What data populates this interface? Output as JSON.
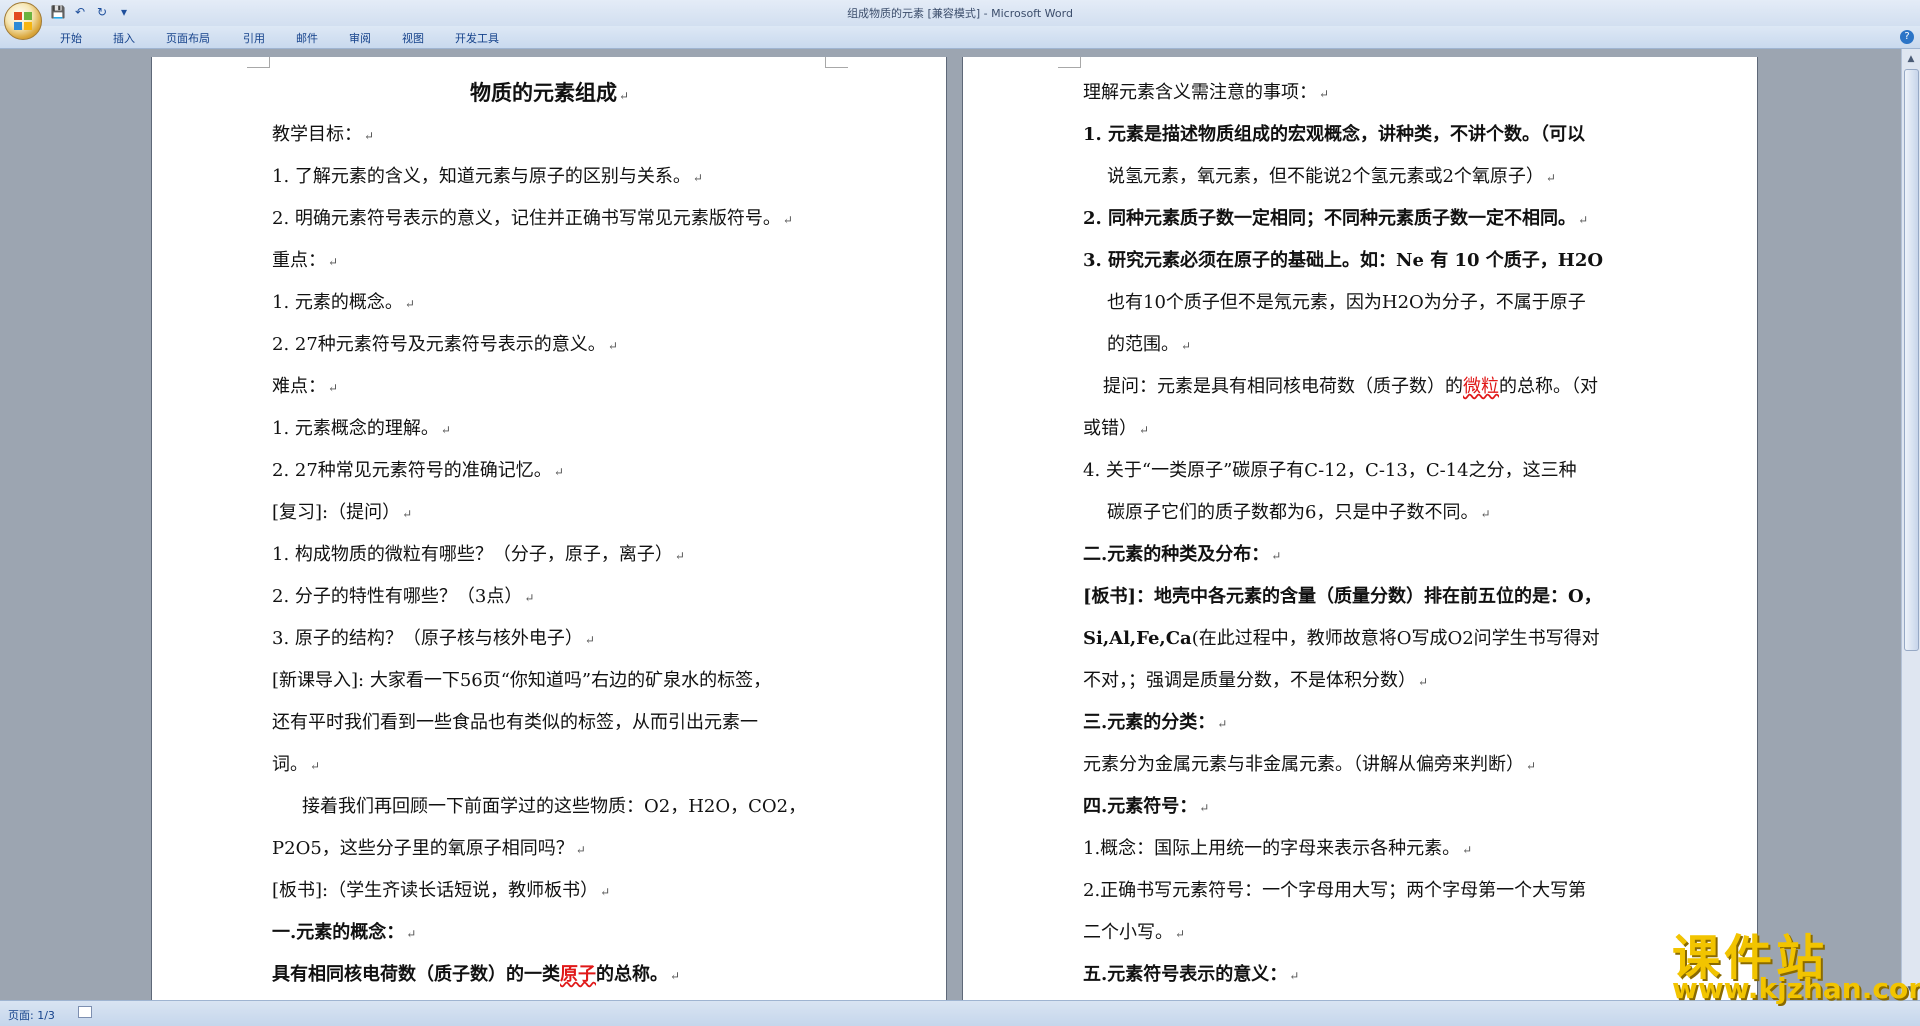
{
  "window": {
    "title": "组成物质的元素 [兼容模式] - Microsoft Word"
  },
  "qat": {
    "save": "💾",
    "undo": "↶",
    "redo": "↻",
    "customize": "▾"
  },
  "ribbon": {
    "tabs": [
      "开始",
      "插入",
      "页面布局",
      "引用",
      "邮件",
      "审阅",
      "视图",
      "开发工具"
    ],
    "help": "?"
  },
  "status": {
    "page": "页面: 1/3"
  },
  "watermark": {
    "brand": "课件站",
    "url": "www.kjzhan.com"
  },
  "colors": {
    "accent": "#15428b",
    "highlight_red": "#e01818",
    "watermark": "#f2c400"
  },
  "doc": {
    "left_page": {
      "title": "物质的元素组成",
      "lines": [
        "教学目标：",
        "1. 了解元素的含义，知道元素与原子的区别与关系。",
        "2. 明确元素符号表示的意义，记住并正确书写常见元素版符号。",
        "重点：",
        "1. 元素的概念。",
        "2. 27种元素符号及元素符号表示的意义。",
        "难点：",
        "1. 元素概念的理解。",
        "2. 27种常见元素符号的准确记忆。",
        "[复习]:（提问）",
        "1. 构成物质的微粒有哪些？（分子，原子，离子）",
        "2. 分子的特性有哪些？（3点）",
        "3. 原子的结构？（原子核与核外电子）",
        "[新课导入]: 大家看一下56页“你知道吗”右边的矿泉水的标签，",
        "还有平时我们看到一些食品也有类似的标签，从而引出元素一",
        "词。",
        "接着我们再回顾一下前面学过的这些物质：O2，H2O，CO2，",
        "P2O5，这些分子里的氧原子相同吗？",
        "[板书]:（学生齐读长话短说，教师板书）",
        "一.元素的概念："
      ],
      "last_line": {
        "before": "具有相同核电荷数（质子数）的一类",
        "red": "原子",
        "after": "的总称。"
      }
    },
    "right_page": {
      "lines": [
        "理解元素含义需注意的事项：",
        "1. 元素是描述物质组成的宏观概念，讲种类，不讲个数。（可以",
        "说氢元素，氧元素，但不能说2个氢元素或2个氧原子）",
        "2. 同种元素质子数一定相同；不同种元素质子数一定不相同。",
        "3. 研究元素必须在原子的基础上。如：Ne 有 10 个质子，H2O",
        "也有10个质子但不是氖元素，因为H2O为分子，不属于原子",
        "的范围。",
        "或错）",
        "4. 关于“一类原子”碳原子有C-12，C-13，C-14之分，这三种",
        "碳原子它们的质子数都为6，只是中子数不同。",
        "二.元素的种类及分布：",
        "[板书]：地壳中各元素的含量（质量分数）排在前五位的是：O，",
        "不对，；强调是质量分数，不是体积分数）",
        "三.元素的分类：",
        "元素分为金属元素与非金属元素。（讲解从偏旁来判断）",
        "四.元素符号：",
        "1.概念：国际上用统一的字母来表示各种元素。",
        "2.正确书写元素符号：一个字母用大写；两个字母第一个大写第",
        "二个小写。",
        "五.元素符号表示的意义："
      ],
      "question": {
        "before": "提问：元素是具有相同核电荷数（质子数）的",
        "red": "微粒",
        "after": "的总称。（对"
      },
      "sial": {
        "bold": "Si,Al,Fe,Ca",
        "rest": "(在此过程中，教师故意将O写成O2问学生书写得对"
      }
    }
  }
}
